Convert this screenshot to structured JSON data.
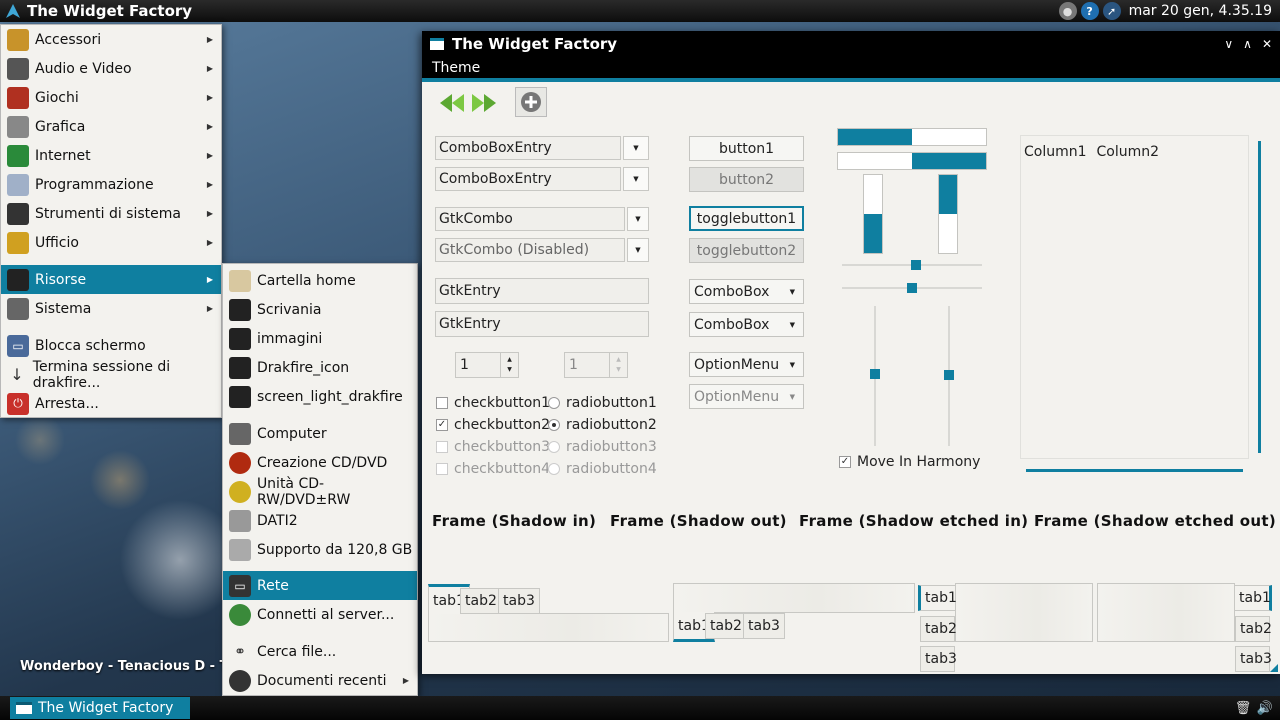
{
  "top_panel": {
    "title": "The Widget Factory",
    "clock": "mar 20 gen,  4.35.19",
    "icons": [
      "user-icon",
      "help-icon",
      "cursor-icon"
    ]
  },
  "bottom_panel": {
    "task_label": "The Widget Factory",
    "icons": [
      "trash-icon",
      "volume-icon"
    ]
  },
  "desktop": {
    "song_text": "Wonderboy - Tenacious D - Ten"
  },
  "main_menu": {
    "items": [
      {
        "label": "Accessori",
        "icon": "accessories-icon",
        "color": "#c8932a"
      },
      {
        "label": "Audio e Video",
        "icon": "multimedia-icon",
        "color": "#555555"
      },
      {
        "label": "Giochi",
        "icon": "games-icon",
        "color": "#b03020"
      },
      {
        "label": "Grafica",
        "icon": "graphics-icon",
        "color": "#888888"
      },
      {
        "label": "Internet",
        "icon": "internet-icon",
        "color": "#2a8a3a"
      },
      {
        "label": "Programmazione",
        "icon": "programming-icon",
        "color": "#a0b0c8"
      },
      {
        "label": "Strumenti di sistema",
        "icon": "system-tools-icon",
        "color": "#333333"
      },
      {
        "label": "Ufficio",
        "icon": "office-icon",
        "color": "#d0a020"
      }
    ],
    "risorse": "Risorse",
    "sistema": "Sistema",
    "blocca": "Blocca schermo",
    "termina": "Termina sessione di drakfire...",
    "arresta": "Arresta..."
  },
  "submenu": {
    "places": [
      "Cartella home",
      "Scrivania",
      "immagini",
      "Drakfire_icon",
      "screen_light_drakfire"
    ],
    "devices": [
      "Computer",
      "Creazione CD/DVD",
      "Unità CD-RW/DVD±RW",
      "DATI2",
      "Supporto da 120,8 GB"
    ],
    "rete": "Rete",
    "connetti": "Connetti al server...",
    "cerca": "Cerca file...",
    "documenti": "Documenti recenti"
  },
  "window": {
    "title": "The Widget Factory",
    "menu_theme": "Theme",
    "combobox_entry_1": "ComboBoxEntry",
    "combobox_entry_2": "ComboBoxEntry",
    "gtkcombo": "GtkCombo",
    "gtkcombo_disabled": "GtkCombo (Disabled)",
    "gtkentry_1": "GtkEntry",
    "gtkentry_2": "GtkEntry",
    "spin_1": "1",
    "spin_2": "1",
    "checkbuttons": [
      "checkbutton1",
      "checkbutton2",
      "checkbutton3",
      "checkbutton4"
    ],
    "radiobuttons": [
      "radiobutton1",
      "radiobutton2",
      "radiobutton3",
      "radiobutton4"
    ],
    "button1": "button1",
    "button2": "button2",
    "togglebutton1": "togglebutton1",
    "togglebutton2": "togglebutton2",
    "combobox_1": "ComboBox",
    "combobox_2": "ComboBox",
    "optionmenu_1": "OptionMenu",
    "optionmenu_2": "OptionMenu",
    "move_in_harmony": "Move In Harmony",
    "column1": "Column1",
    "column2": "Column2",
    "frames": [
      "Frame (Shadow in)",
      "Frame (Shadow out)",
      "Frame (Shadow etched in)",
      "Frame (Shadow etched out)"
    ],
    "tabs": [
      "tab1",
      "tab2",
      "tab3"
    ],
    "accent": "#0f7fa0",
    "progress": {
      "h1": 0.5,
      "h2": 0.5,
      "v1": 0.5,
      "v2": 0.5
    }
  }
}
